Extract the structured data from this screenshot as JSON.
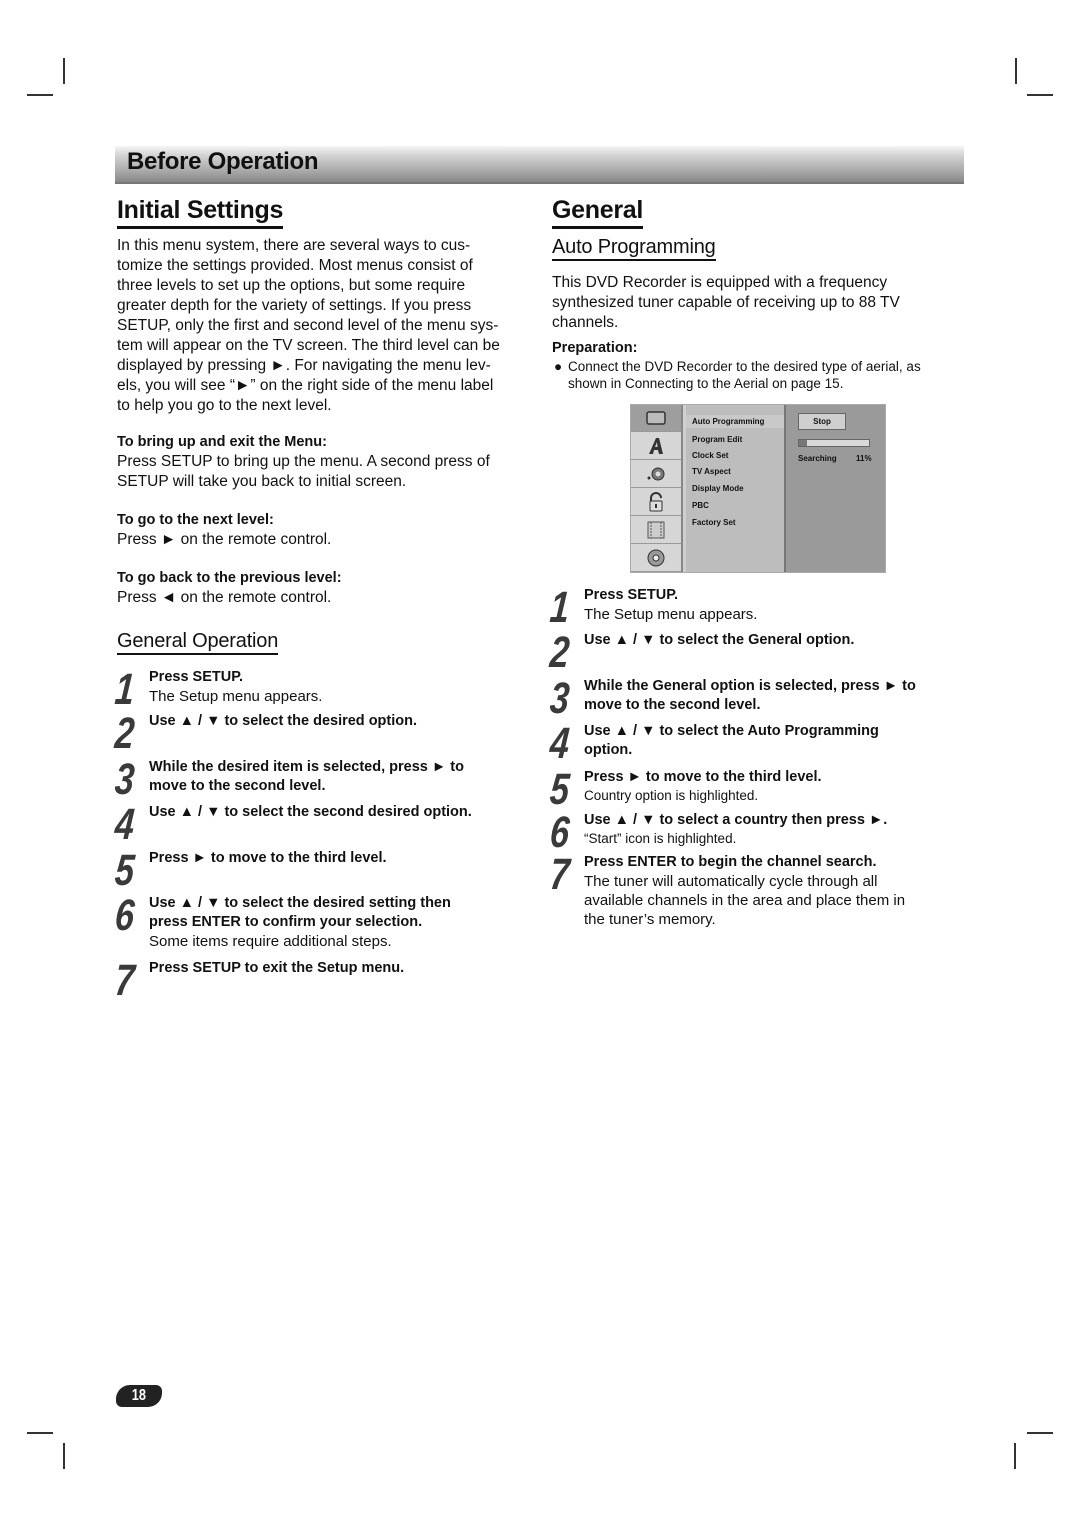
{
  "banner": {
    "title": "Before Operation"
  },
  "left": {
    "heading": "Initial Settings",
    "intro": "In this menu system, there are several ways to customize the settings provided. Most menus consist of three levels to set up the options, but some require greater depth for the variety of settings. If you press SETUP, only the first and second level of the menu system will appear on the TV screen. The third level can be displayed by pressing ►. For navigating the menu levels, you will see “►” on the right side of the menu label to help you go to the next level.",
    "intro_lines": [
      "In this menu system, there are several ways to cus-",
      "tomize the settings provided. Most menus consist of",
      "three levels to set up the options, but some require",
      "greater depth for the variety of settings. If you press",
      "SETUP, only the first and second level of the menu sys-",
      "tem will appear on the TV screen. The third level can be",
      "displayed by pressing ►. For navigating the menu lev-",
      "els, you will see “►” on the right side of the menu label",
      "to help you go to the next level."
    ],
    "sections": [
      {
        "title": "To bring up and exit the Menu:",
        "body": [
          "Press SETUP to bring up the menu. A second press of",
          "SETUP will take you back to initial screen."
        ]
      },
      {
        "title": "To go to the next level:",
        "body": [
          "Press ► on the remote control."
        ]
      },
      {
        "title": "To go back to the previous level:",
        "body": [
          "Press ◄ on the remote control."
        ]
      }
    ],
    "subheading": "General Operation",
    "steps": [
      {
        "num": "1",
        "bold": [
          "Press SETUP."
        ],
        "normal": [
          "The Setup menu appears."
        ]
      },
      {
        "num": "2",
        "bold": [
          "Use ▲ / ▼ to select the desired option."
        ],
        "normal": []
      },
      {
        "num": "3",
        "bold": [
          "While the desired item is selected, press ► to",
          "move to the second level."
        ],
        "normal": []
      },
      {
        "num": "4",
        "bold": [
          "Use ▲ / ▼ to select the second desired option."
        ],
        "normal": []
      },
      {
        "num": "5",
        "bold": [
          "Press ► to move to the third level."
        ],
        "normal": []
      },
      {
        "num": "6",
        "bold": [
          "Use ▲ / ▼ to select the desired setting then",
          "press ENTER to confirm your selection."
        ],
        "normal": [
          "Some items require additional steps."
        ]
      },
      {
        "num": "7",
        "bold": [
          "Press SETUP to exit the Setup menu."
        ],
        "normal": []
      }
    ]
  },
  "right": {
    "heading": "General",
    "subheading": "Auto Programming",
    "intro_lines": [
      "This DVD Recorder is equipped with a frequency",
      "synthesized tuner capable of receiving up to 88 TV",
      "channels."
    ],
    "preparation_title": "Preparation:",
    "preparation_lines": [
      "Connect the DVD Recorder to the desired type of aerial, as",
      "shown in Connecting to the Aerial on page 15."
    ],
    "menu": {
      "icons": [
        "tv-screen-icon",
        "language-a-icon",
        "audio-speaker-icon",
        "lock-icon",
        "film-icon",
        "disc-icon"
      ],
      "items": [
        "Auto Programming",
        "Program Edit",
        "Clock Set",
        "TV Aspect",
        "Display Mode",
        "PBC",
        "Factory Set"
      ],
      "selected_item": "Auto Programming",
      "stop_label": "Stop",
      "status_label": "Searching",
      "progress_percent": 11,
      "progress_text": "11%"
    },
    "steps": [
      {
        "num": "1",
        "bold": [
          "Press SETUP."
        ],
        "normal": [
          "The Setup menu appears."
        ],
        "small": []
      },
      {
        "num": "2",
        "bold": [
          "Use ▲ / ▼ to select the General option."
        ],
        "normal": [],
        "small": []
      },
      {
        "num": "3",
        "bold": [
          "While the General option is selected, press ► to",
          "move to the second level."
        ],
        "normal": [],
        "small": []
      },
      {
        "num": "4",
        "bold": [
          "Use ▲ / ▼ to select the Auto Programming",
          "option."
        ],
        "normal": [],
        "small": []
      },
      {
        "num": "5",
        "bold": [
          "Press ► to move to the third level."
        ],
        "normal": [],
        "small": [
          "Country option is highlighted."
        ]
      },
      {
        "num": "6",
        "bold": [
          "Use ▲ / ▼ to select a country then press ►."
        ],
        "normal": [],
        "small": [
          "“Start” icon is highlighted."
        ]
      },
      {
        "num": "7",
        "bold": [
          "Press ENTER to begin the channel search."
        ],
        "normal": [
          "The tuner will automatically cycle through all",
          "available channels in the area and place them in",
          "the tuner’s memory."
        ],
        "small": []
      }
    ]
  },
  "page_number": "18"
}
